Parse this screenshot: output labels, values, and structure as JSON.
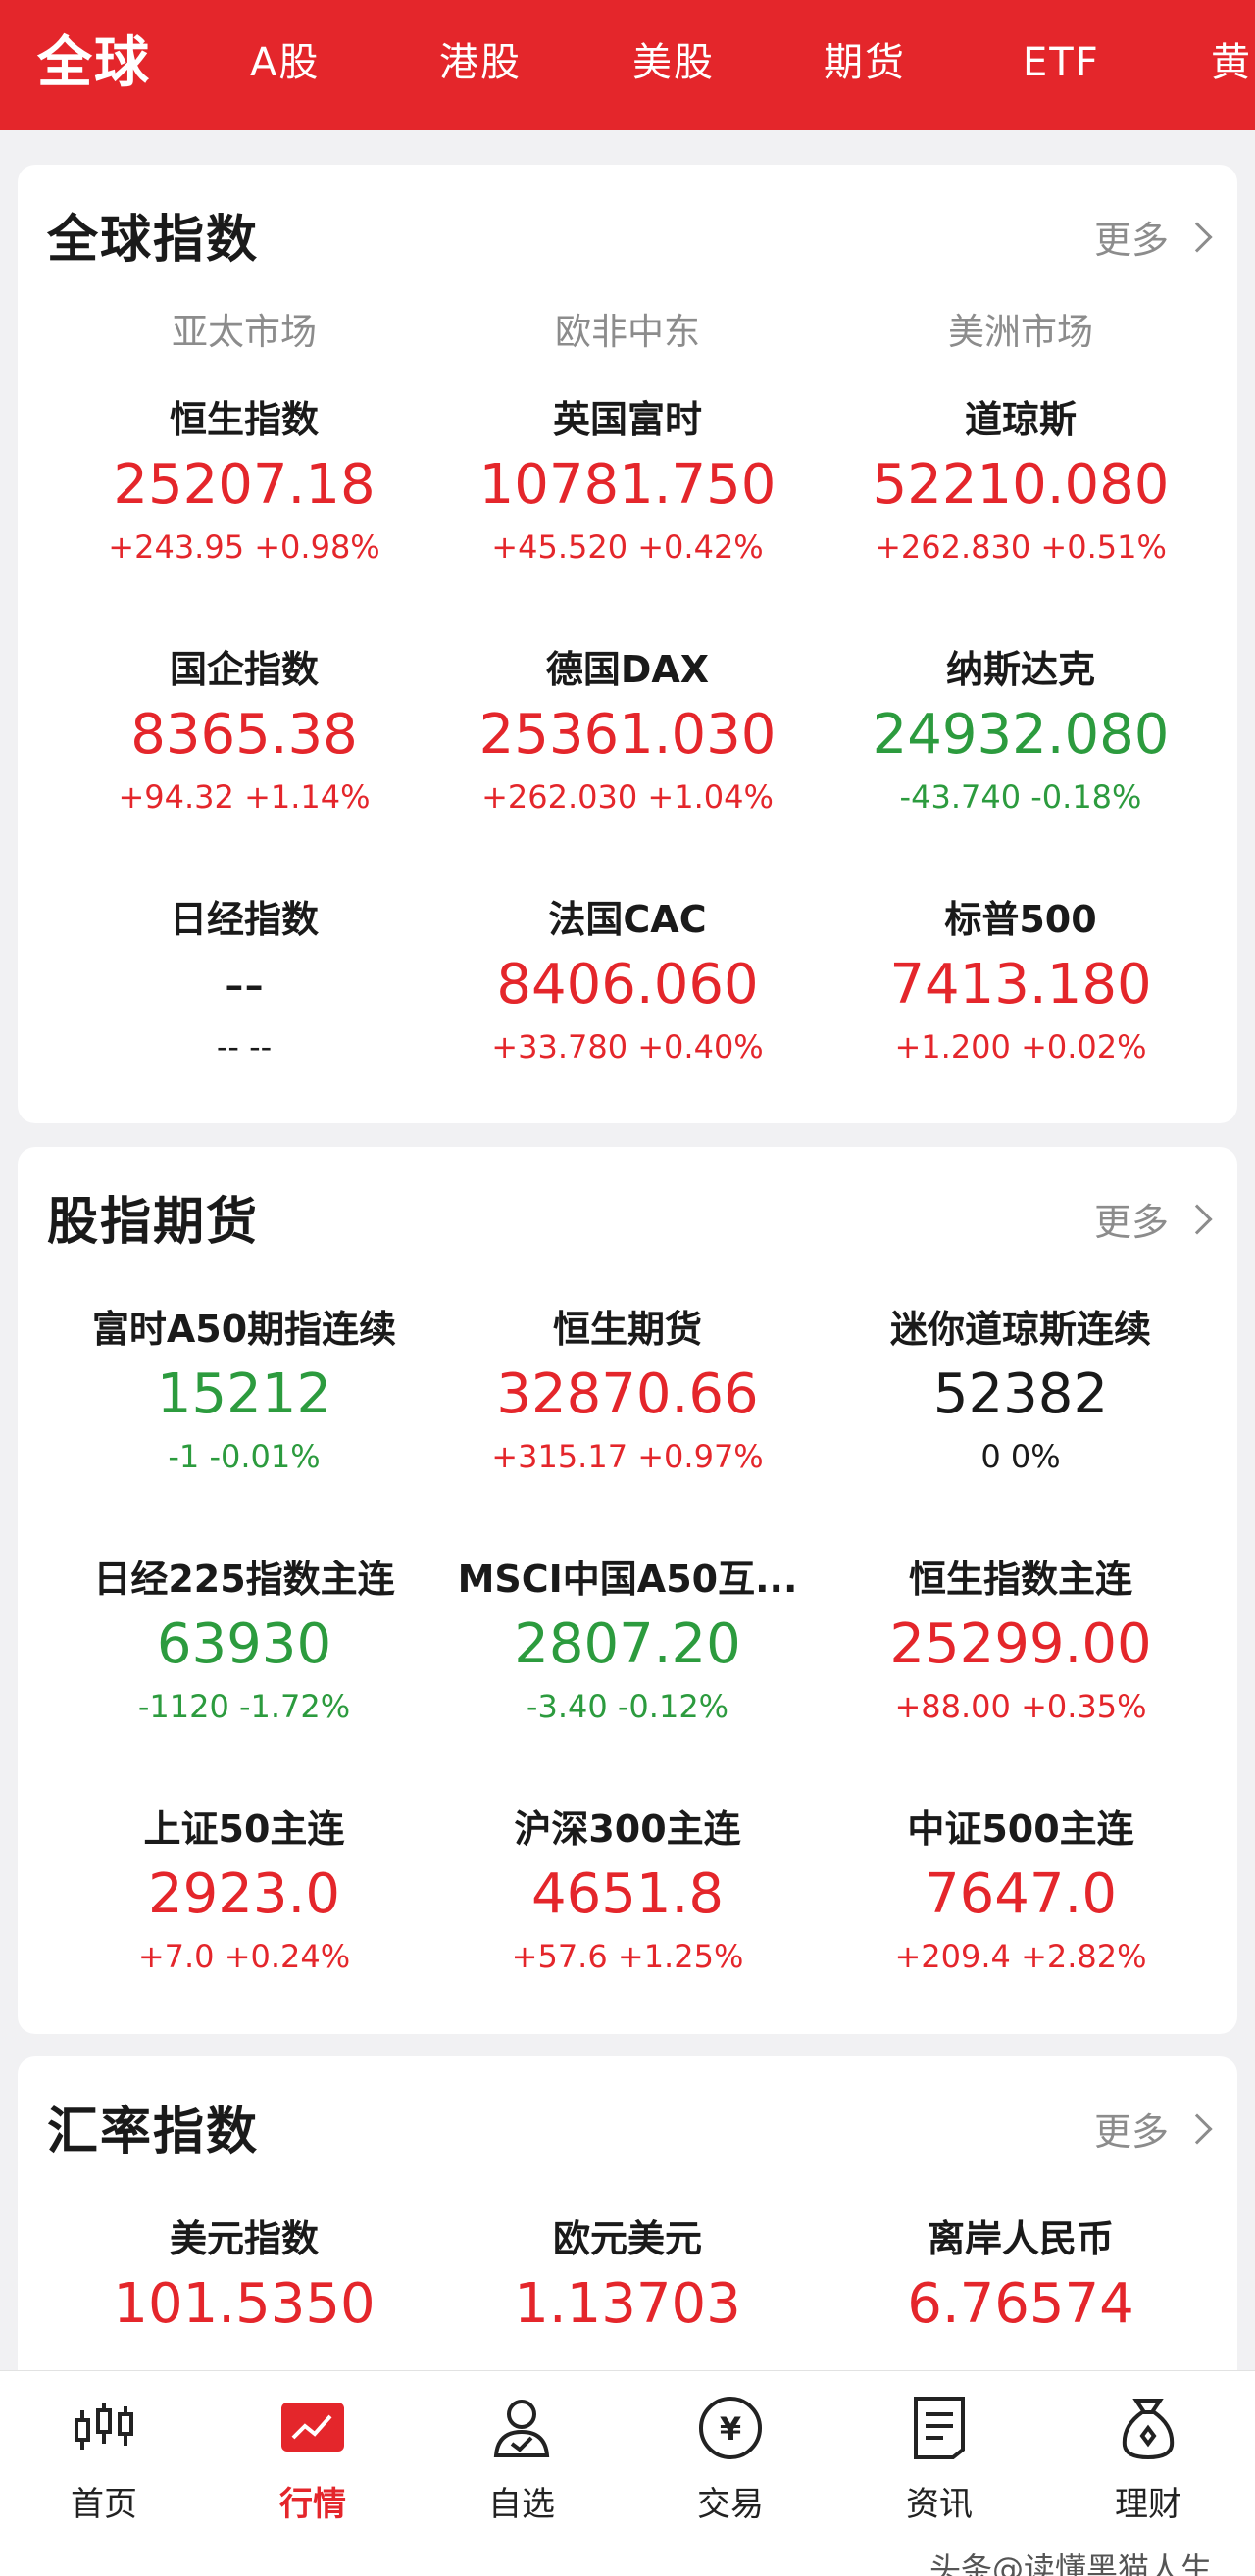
{
  "tabs": [
    "全球",
    "A股",
    "港股",
    "美股",
    "期货",
    "ETF",
    "黄"
  ],
  "colors": {
    "brand": "#e4262b",
    "up": "#e4262b",
    "down": "#2c9b3e"
  },
  "global": {
    "title": "全球指数",
    "more": "更多",
    "regions": [
      "亚太市场",
      "欧非中东",
      "美洲市场"
    ],
    "items": [
      {
        "name": "恒生指数",
        "value": "25207.18",
        "change": "+243.95  +0.98%",
        "trend": "up"
      },
      {
        "name": "英国富时",
        "value": "10781.750",
        "change": "+45.520  +0.42%",
        "trend": "up"
      },
      {
        "name": "道琼斯",
        "value": "52210.080",
        "change": "+262.830  +0.51%",
        "trend": "up"
      },
      {
        "name": "国企指数",
        "value": "8365.38",
        "change": "+94.32  +1.14%",
        "trend": "up"
      },
      {
        "name": "德国DAX",
        "value": "25361.030",
        "change": "+262.030  +1.04%",
        "trend": "up"
      },
      {
        "name": "纳斯达克",
        "value": "24932.080",
        "change": "-43.740  -0.18%",
        "trend": "down"
      },
      {
        "name": "日经指数",
        "value": "--",
        "change": "--  --",
        "trend": "flat"
      },
      {
        "name": "法国CAC",
        "value": "8406.060",
        "change": "+33.780  +0.40%",
        "trend": "up"
      },
      {
        "name": "标普500",
        "value": "7413.180",
        "change": "+1.200  +0.02%",
        "trend": "up"
      }
    ]
  },
  "futures": {
    "title": "股指期货",
    "more": "更多",
    "items": [
      {
        "name": "富时A50期指连续",
        "value": "15212",
        "change": "-1  -0.01%",
        "trend": "down"
      },
      {
        "name": "恒生期货",
        "value": "32870.66",
        "change": "+315.17  +0.97%",
        "trend": "up"
      },
      {
        "name": "迷你道琼斯连续",
        "value": "52382",
        "change": "0  0%",
        "trend": "flat"
      },
      {
        "name": "日经225指数主连",
        "value": "63930",
        "change": "-1120  -1.72%",
        "trend": "down"
      },
      {
        "name": "MSCI中国A50互...",
        "value": "2807.20",
        "change": "-3.40  -0.12%",
        "trend": "down"
      },
      {
        "name": "恒生指数主连",
        "value": "25299.00",
        "change": "+88.00  +0.35%",
        "trend": "up"
      },
      {
        "name": "上证50主连",
        "value": "2923.0",
        "change": "+7.0  +0.24%",
        "trend": "up"
      },
      {
        "name": "沪深300主连",
        "value": "4651.8",
        "change": "+57.6  +1.25%",
        "trend": "up"
      },
      {
        "name": "中证500主连",
        "value": "7647.0",
        "change": "+209.4  +2.82%",
        "trend": "up"
      }
    ]
  },
  "fx": {
    "title": "汇率指数",
    "more": "更多",
    "items": [
      {
        "name": "美元指数",
        "value": "101.5350",
        "trend": "up"
      },
      {
        "name": "欧元美元",
        "value": "1.13703",
        "trend": "up"
      },
      {
        "name": "离岸人民币",
        "value": "6.76574",
        "trend": "up"
      }
    ]
  },
  "bottom_nav": [
    {
      "label": "首页",
      "icon": "candlestick-icon"
    },
    {
      "label": "行情",
      "icon": "market-chart-icon"
    },
    {
      "label": "自选",
      "icon": "user-check-icon"
    },
    {
      "label": "交易",
      "icon": "yuan-coin-icon"
    },
    {
      "label": "资讯",
      "icon": "news-document-icon"
    },
    {
      "label": "理财",
      "icon": "money-bag-icon"
    }
  ],
  "watermark": "头条@读懂黑猫人生"
}
